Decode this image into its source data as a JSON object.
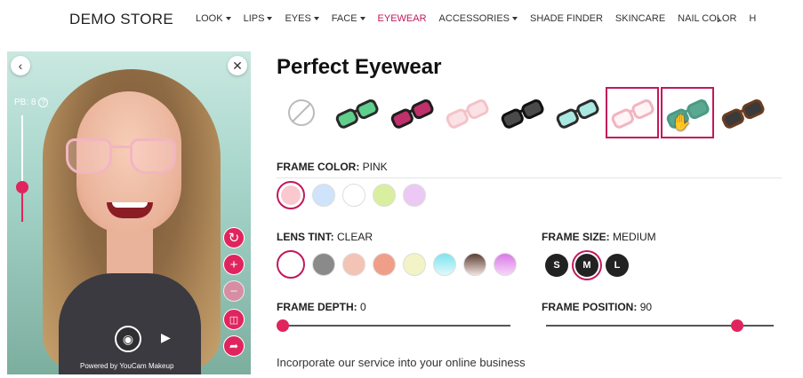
{
  "store": {
    "name": "DEMO STORE"
  },
  "nav": {
    "items": [
      {
        "label": "LOOK",
        "dropdown": true
      },
      {
        "label": "LIPS",
        "dropdown": true
      },
      {
        "label": "EYES",
        "dropdown": true
      },
      {
        "label": "FACE",
        "dropdown": true
      },
      {
        "label": "EYEWEAR",
        "dropdown": false,
        "active": true
      },
      {
        "label": "ACCESSORIES",
        "dropdown": true
      },
      {
        "label": "SHADE FINDER",
        "dropdown": false
      },
      {
        "label": "SKINCARE",
        "dropdown": false
      },
      {
        "label": "NAIL COLOR",
        "dropdown": false
      },
      {
        "label": "H",
        "dropdown": false
      }
    ],
    "more_icon": "chevron-right-icon"
  },
  "camera": {
    "pb_label": "PB: 8",
    "help": "?",
    "back_icon": "chevron-left-icon",
    "close_icon": "close-icon",
    "slider_level": 0.65,
    "side_buttons": [
      "rotate-icon",
      "zoom-in-icon",
      "zoom-out-icon",
      "compare-icon",
      "share-icon"
    ],
    "shutter_icon": "camera-icon",
    "video_icon": "video-icon",
    "powered_by": "Powered by YouCam Makeup"
  },
  "main": {
    "title": "Perfect Eyewear",
    "styles": [
      {
        "name": "none"
      },
      {
        "name": "green-mirror-sport",
        "frame": "#2a2a2a",
        "lens": "#5fd08b"
      },
      {
        "name": "red-purple-sport",
        "frame": "#1e1e1e",
        "lens": "#c0306a"
      },
      {
        "name": "pink-round",
        "frame": "#f4c3c8",
        "lens": "#fbe2e6"
      },
      {
        "name": "black-cat-eye",
        "frame": "#111111",
        "lens": "#4a4a4a"
      },
      {
        "name": "mint-square",
        "frame": "#2b2b2b",
        "lens": "#a8e8e0"
      },
      {
        "name": "pink-cat-eye",
        "frame": "#f2b4c0",
        "lens": "#fff5f7",
        "selected": true
      },
      {
        "name": "green-aviator",
        "frame": "#4a9a86",
        "lens": "#5aa88f",
        "selected": true
      },
      {
        "name": "tortoise-cat-eye",
        "frame": "#6b3d20",
        "lens": "#3a3a3a"
      }
    ],
    "frame_color": {
      "label": "FRAME COLOR:",
      "value": "PINK",
      "swatches": [
        "#f9c9cf",
        "#cfe3fb",
        "#ffffff",
        "#d9efa0",
        "#ecc9f5"
      ],
      "selected": 0
    },
    "lens_tint": {
      "label": "LENS TINT:",
      "value": "CLEAR",
      "swatches": [
        "#ffffff",
        "#8a8a8a",
        "#f3c4b5",
        "#ef9f88",
        "#f2f3c7",
        "#a9eaf1",
        "#a38377",
        "#e7a2ee"
      ],
      "selected": 0
    },
    "frame_size": {
      "label": "FRAME SIZE:",
      "value": "MEDIUM",
      "options": [
        "S",
        "M",
        "L"
      ],
      "selected": 1
    },
    "frame_depth": {
      "label": "FRAME DEPTH:",
      "value": "0"
    },
    "frame_position": {
      "label": "FRAME POSITION:",
      "value": "90"
    },
    "footer": "Incorporate our service into your online business"
  },
  "colors": {
    "accent": "#c2185b",
    "accent_button": "#e0245e"
  }
}
